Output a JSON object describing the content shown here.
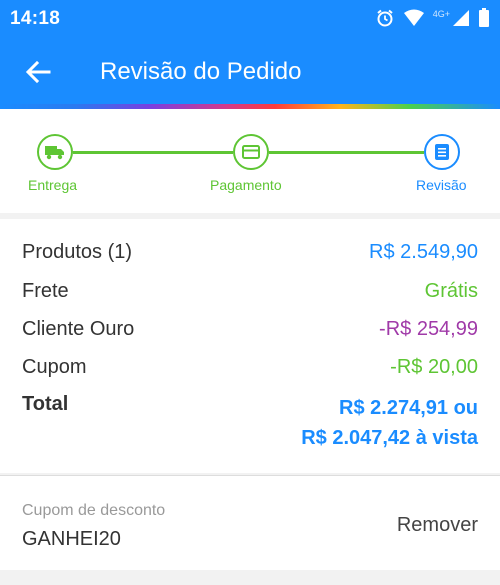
{
  "status_bar": {
    "time": "14:18",
    "network_label": "4G+",
    "icons": [
      "alarm-icon",
      "wifi-icon",
      "signal-icon",
      "battery-icon"
    ]
  },
  "app_bar": {
    "title": "Revisão do Pedido",
    "back_icon": "arrow-left-icon"
  },
  "stepper": {
    "steps": [
      {
        "label": "Entrega",
        "icon": "truck-icon",
        "state": "done"
      },
      {
        "label": "Pagamento",
        "icon": "credit-card-icon",
        "state": "done"
      },
      {
        "label": "Revisão",
        "icon": "document-icon",
        "state": "active"
      }
    ]
  },
  "summary": {
    "products": {
      "label": "Produtos (1)",
      "value": "R$ 2.549,90"
    },
    "shipping": {
      "label": "Frete",
      "value": "Grátis"
    },
    "gold_client": {
      "label": "Cliente Ouro",
      "value": "-R$ 254,99"
    },
    "coupon": {
      "label": "Cupom",
      "value": "-R$ 20,00"
    },
    "total": {
      "label": "Total",
      "value_installments": "R$ 2.274,91 ou",
      "value_cash": "R$ 2.047,42 à vista"
    }
  },
  "discount_coupon": {
    "caption": "Cupom de desconto",
    "code": "GANHEI20",
    "remove_label": "Remover"
  },
  "colors": {
    "primary": "#1a8cff",
    "success": "#5ec534",
    "discount_purple": "#a03aa8"
  }
}
